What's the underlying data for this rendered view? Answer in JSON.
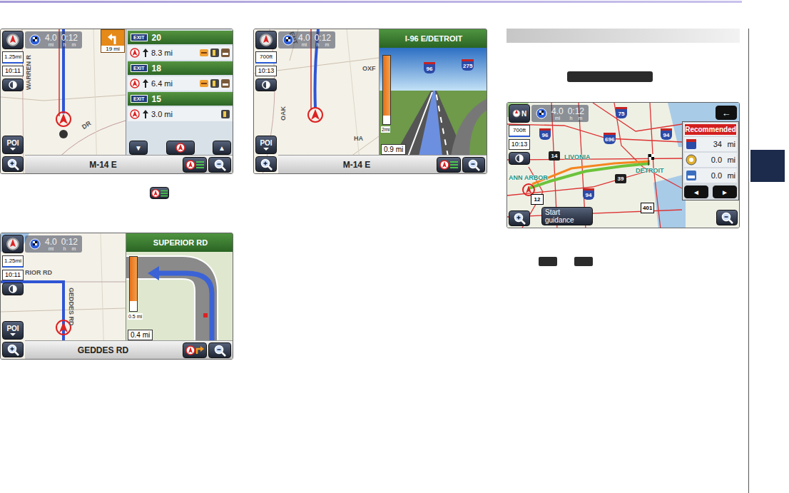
{
  "chapter_tabs": [
    {
      "selected": false
    },
    {
      "selected": false
    },
    {
      "selected": true
    },
    {
      "selected": false
    },
    {
      "selected": false
    },
    {
      "selected": false
    },
    {
      "selected": false
    },
    {
      "selected": false
    },
    {
      "selected": false
    },
    {
      "selected": false
    },
    {
      "selected": false
    }
  ],
  "screens": [
    {
      "kind": "exits",
      "trip": {
        "distance": "4.0",
        "distance_unit": "mi",
        "time": "0:12",
        "time_units": [
          "h",
          "m"
        ]
      },
      "turn_distance": "19 mi",
      "scale": "1.25mi",
      "clock": "10:11",
      "poi": "POI",
      "road": "M-14 E",
      "labels": [
        "WARREN R",
        "DR"
      ],
      "panel": {
        "exits": [
          {
            "badge": "EXIT",
            "number": "20",
            "distance": "8.3 mi",
            "services": 3
          },
          {
            "badge": "EXIT",
            "number": "18",
            "distance": "6.4 mi",
            "services": 3
          },
          {
            "badge": "EXIT",
            "number": "15",
            "distance": "3.0 mi",
            "services": 1
          }
        ],
        "down": "▼",
        "up": "▲"
      }
    },
    {
      "kind": "junction",
      "trip": {
        "distance": "4.0",
        "distance_unit": "mi",
        "time": "0:12",
        "time_units": [
          "h",
          "m"
        ]
      },
      "scale": "700ft",
      "clock": "10:13",
      "poi": "POI",
      "road": "M-14 E",
      "labels": [
        "ENT",
        "OXF",
        "OAK",
        "HA"
      ],
      "panel": {
        "title": "I-96 E/DETROIT",
        "shields": [
          "96",
          "275"
        ],
        "bar_label": "2mi",
        "level": 0.88,
        "distance": "0.9 mi"
      }
    },
    {
      "kind": "turn",
      "trip": {
        "distance": "4.0",
        "distance_unit": "mi",
        "time": "0:12",
        "time_units": [
          "h",
          "m"
        ]
      },
      "scale": "1.25mi",
      "clock": "10:11",
      "poi": "POI",
      "road": "GEDDES RD",
      "labels": [
        "RIOR RD",
        "GEDDES RD"
      ],
      "panel": {
        "title": "SUPERIOR RD",
        "bar_label": "0.5 mi",
        "level": 0.82,
        "distance": "0.4 mi"
      }
    },
    {
      "kind": "routes",
      "compass": "N",
      "trip": {
        "distance": "4.0",
        "distance_unit": "mi",
        "time": "0:12",
        "time_units": [
          "h",
          "m"
        ]
      },
      "scale": "700ft",
      "clock": "10:13",
      "start": "Start guidance",
      "labels": [
        "LIVONIA",
        "DETROIT",
        "ANN ARBOR"
      ],
      "shields": [
        {
          "text": "75",
          "kind": "interstate"
        },
        {
          "text": "96",
          "kind": "interstate"
        },
        {
          "text": "696",
          "kind": "interstate"
        },
        {
          "text": "94",
          "kind": "interstate"
        },
        {
          "text": "14",
          "kind": "state"
        },
        {
          "text": "94",
          "kind": "interstate"
        },
        {
          "text": "12",
          "kind": "us"
        },
        {
          "text": "39",
          "kind": "state"
        },
        {
          "text": "401",
          "kind": "provincial"
        }
      ],
      "panel": {
        "back": "←",
        "title": "Recommended",
        "rows": [
          {
            "value": "34",
            "unit": "mi"
          },
          {
            "value": "0.0",
            "unit": "mi"
          },
          {
            "value": "0.0",
            "unit": "mi"
          }
        ],
        "prev": "◄",
        "next": "►"
      }
    }
  ]
}
